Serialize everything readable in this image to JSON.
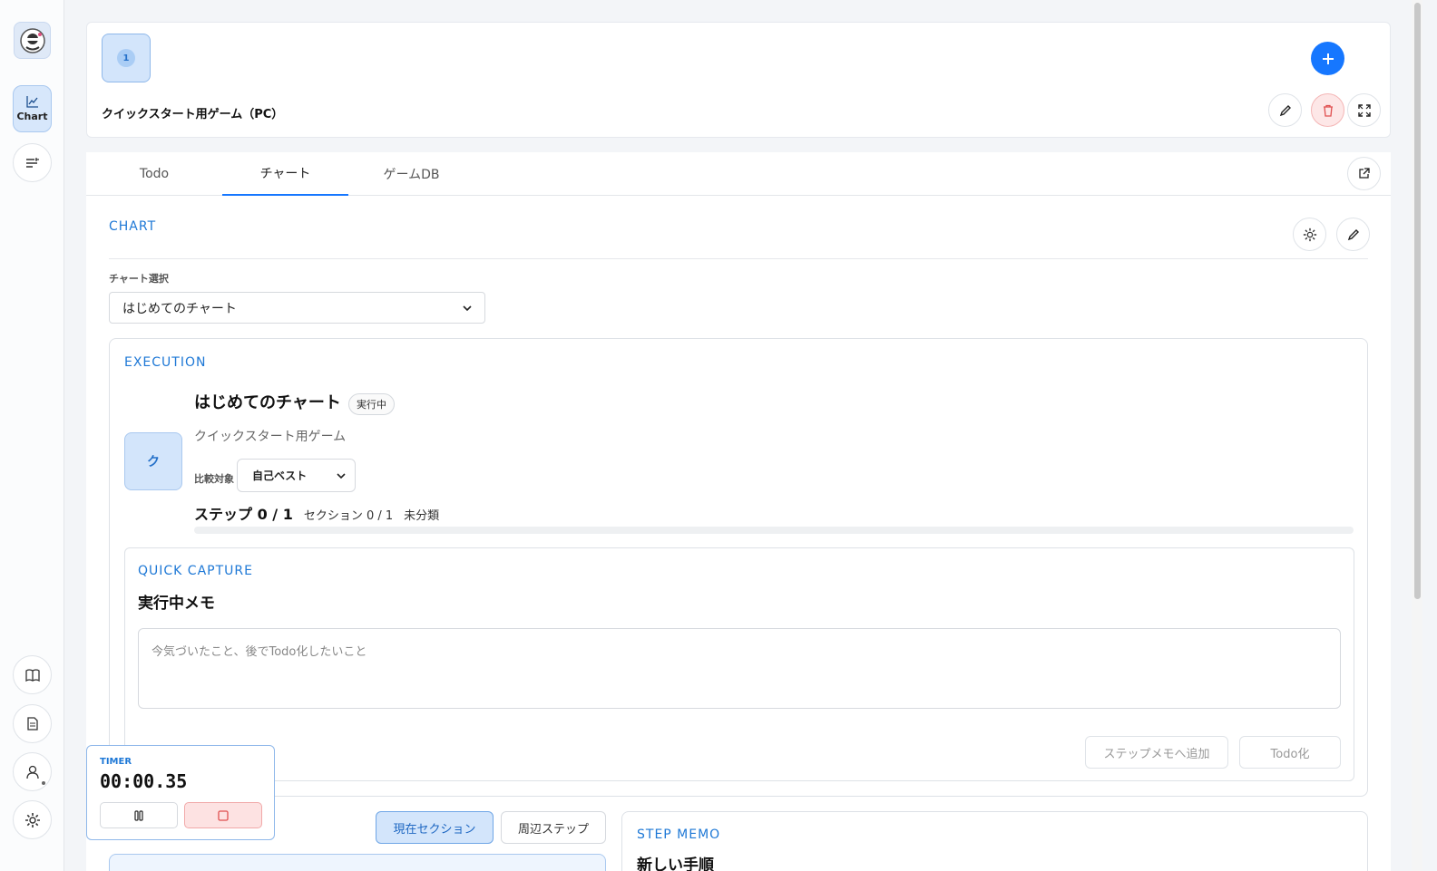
{
  "sidebar": {
    "chart_label": "Chart",
    "icons": [
      "avatar-logo",
      "chart-icon",
      "list-filter-icon",
      "book-icon",
      "document-icon",
      "user-icon",
      "gear-icon"
    ]
  },
  "header": {
    "game_number": "1",
    "game_title": "クイックスタート用ゲーム（PC）"
  },
  "tabs": [
    {
      "label": "Todo"
    },
    {
      "label": "チャート"
    },
    {
      "label": "ゲームDB"
    }
  ],
  "chart": {
    "section_label": "CHART",
    "select_label": "チャート選択",
    "selected_chart": "はじめてのチャート"
  },
  "execution": {
    "section_label": "EXECUTION",
    "thumb_letter": "ク",
    "title": "はじめてのチャート",
    "status_badge": "実行中",
    "game_name": "クイックスタート用ゲーム",
    "compare_label": "比較対象",
    "compare_value": "自己ベスト",
    "step_progress": "ステップ 0 / 1",
    "section_progress": "セクション 0 / 1",
    "category": "未分類",
    "progress": 0
  },
  "quick_capture": {
    "section_label": "QUICK CAPTURE",
    "title": "実行中メモ",
    "placeholder": "今気づいたこと、後でTodo化したいこと",
    "add_to_step_memo": "ステップメモへ追加",
    "to_todo": "Todo化"
  },
  "timer": {
    "label": "TIMER",
    "value": "00:00.35"
  },
  "bottom": {
    "current_section": "現在セクション",
    "nearby_steps": "周辺ステップ",
    "step_memo_label": "STEP MEMO",
    "step_memo_title": "新しい手順"
  },
  "colors": {
    "accent": "#1677ff",
    "danger": "#e05050"
  }
}
